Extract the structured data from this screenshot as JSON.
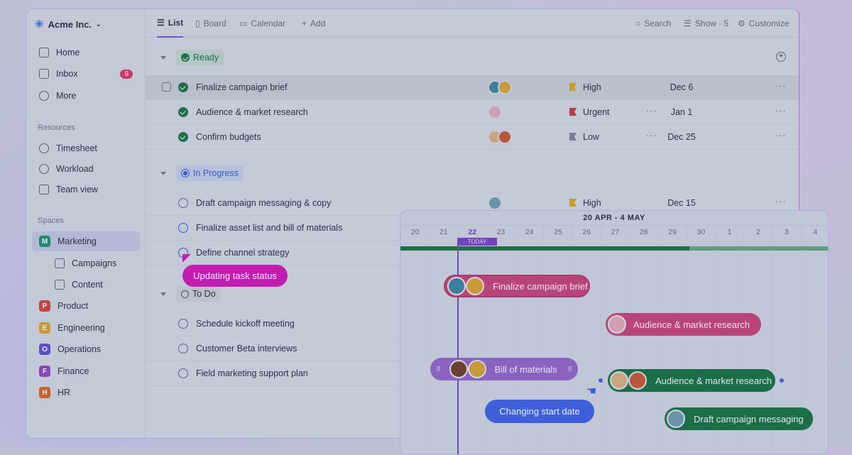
{
  "workspace": {
    "name": "Acme Inc."
  },
  "sidebar": {
    "nav": [
      {
        "label": "Home"
      },
      {
        "label": "Inbox",
        "badge": "9"
      },
      {
        "label": "More"
      }
    ],
    "resources_title": "Resources",
    "resources": [
      {
        "label": "Timesheet"
      },
      {
        "label": "Workload"
      },
      {
        "label": "Team view"
      }
    ],
    "spaces_title": "Spaces",
    "spaces": [
      {
        "label": "Marketing",
        "letter": "M",
        "color": "#1f8a6a"
      },
      {
        "label": "Campaigns"
      },
      {
        "label": "Content"
      },
      {
        "label": "Product",
        "letter": "P",
        "color": "#c0453f"
      },
      {
        "label": "Engineering",
        "letter": "E",
        "color": "#c99a3a"
      },
      {
        "label": "Operations",
        "letter": "O",
        "color": "#5a4fc0"
      },
      {
        "label": "Finance",
        "letter": "F",
        "color": "#8a45b8"
      },
      {
        "label": "HR",
        "letter": "H",
        "color": "#c4602e"
      }
    ]
  },
  "toolbar": {
    "tabs": [
      {
        "label": "List"
      },
      {
        "label": "Board"
      },
      {
        "label": "Calendar"
      },
      {
        "label": "Add"
      }
    ],
    "search": "Search",
    "show": "Show · 5",
    "customize": "Customize"
  },
  "groups": [
    {
      "label": "Ready",
      "tasks": [
        {
          "name": "Finalize campaign brief",
          "priority": "High",
          "priority_color": "#c9a020",
          "date": "Dec 6"
        },
        {
          "name": "Audience & market research",
          "priority": "Urgent",
          "priority_color": "#b83a4a",
          "date": "Jan 1"
        },
        {
          "name": "Confirm budgets",
          "priority": "Low",
          "priority_color": "#7a8090",
          "date": "Dec 25"
        }
      ]
    },
    {
      "label": "In Progress",
      "tasks": [
        {
          "name": "Draft campaign messaging & copy",
          "priority": "High",
          "priority_color": "#c9a020",
          "date": "Dec 15"
        },
        {
          "name": "Finalize asset list and bill of materials"
        },
        {
          "name": "Define channel strategy"
        }
      ]
    },
    {
      "label": "To Do",
      "tasks": [
        {
          "name": "Schedule kickoff meeting"
        },
        {
          "name": "Customer Beta interviews"
        },
        {
          "name": "Field marketing support plan"
        }
      ]
    }
  ],
  "tooltips": {
    "status": "Updating task status",
    "start_date": "Changing start date"
  },
  "gantt": {
    "range": "20 APR - 4 MAY",
    "days": [
      "20",
      "21",
      "22",
      "23",
      "24",
      "25",
      "26",
      "27",
      "28",
      "29",
      "30",
      "1",
      "2",
      "3",
      "4"
    ],
    "today_label": "TODAY",
    "today": "22",
    "bars": [
      {
        "label": "Finalize campaign brief",
        "color": "#b9447a"
      },
      {
        "label": "Audience & market research",
        "color": "#b9447a"
      },
      {
        "label": "Bill of materials",
        "color": "#8a62c2"
      },
      {
        "label": "Audience & market research",
        "color": "#1b6e47"
      },
      {
        "label": "Draft campaign messaging",
        "color": "#1b6e47"
      }
    ]
  }
}
